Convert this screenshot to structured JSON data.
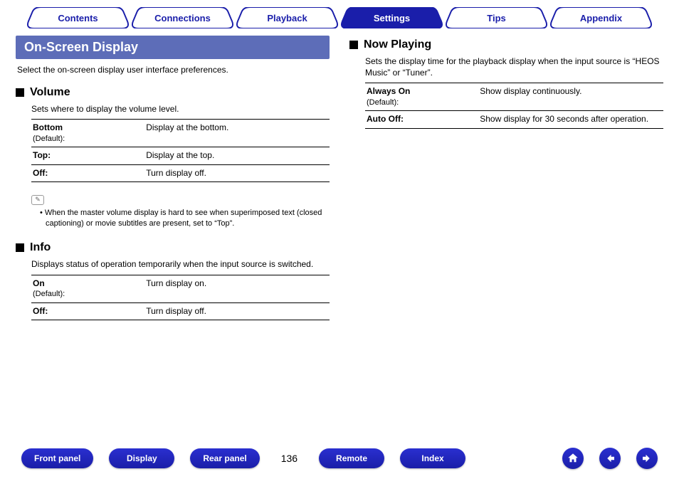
{
  "tabs": {
    "contents": "Contents",
    "connections": "Connections",
    "playback": "Playback",
    "settings": "Settings",
    "tips": "Tips",
    "appendix": "Appendix",
    "active": "settings"
  },
  "left": {
    "title": "On-Screen Display",
    "intro": "Select the on-screen display user interface preferences.",
    "volume": {
      "heading": "Volume",
      "sub": "Sets where to display the volume level.",
      "rows": [
        {
          "name": "Bottom",
          "suffix": "(Default):",
          "desc": "Display at the bottom."
        },
        {
          "name": "Top:",
          "suffix": "",
          "desc": "Display at the top."
        },
        {
          "name": "Off:",
          "suffix": "",
          "desc": "Turn display off."
        }
      ],
      "note": "When the master volume display is hard to see when superimposed text (closed captioning) or movie subtitles are present, set to “Top”."
    },
    "info": {
      "heading": "Info",
      "sub": "Displays status of operation temporarily when the input source is switched.",
      "rows": [
        {
          "name": "On",
          "suffix": "(Default):",
          "desc": "Turn display on."
        },
        {
          "name": "Off:",
          "suffix": "",
          "desc": "Turn display off."
        }
      ]
    }
  },
  "right": {
    "nowplaying": {
      "heading": "Now Playing",
      "sub": "Sets the display time for the playback display when the input source is “HEOS Music” or “Tuner”.",
      "rows": [
        {
          "name": "Always On",
          "suffix": "(Default):",
          "desc": "Show display continuously."
        },
        {
          "name": "Auto Off:",
          "suffix": "",
          "desc": "Show display for 30 seconds after operation."
        }
      ]
    }
  },
  "footer": {
    "front_panel": "Front panel",
    "display": "Display",
    "rear_panel": "Rear panel",
    "page": "136",
    "remote": "Remote",
    "index": "Index"
  }
}
